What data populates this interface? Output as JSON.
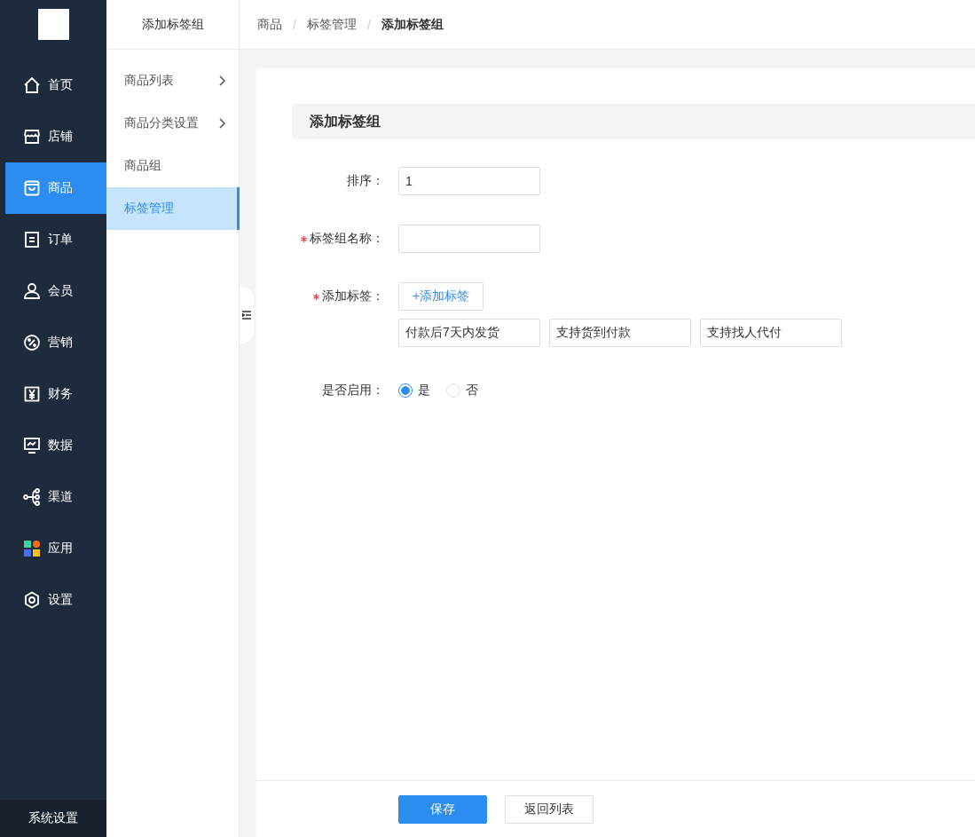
{
  "nav": {
    "items": [
      {
        "label": "首页",
        "selected": false
      },
      {
        "label": "店铺",
        "selected": false
      },
      {
        "label": "商品",
        "selected": true
      },
      {
        "label": "订单",
        "selected": false
      },
      {
        "label": "会员",
        "selected": false
      },
      {
        "label": "营销",
        "selected": false
      },
      {
        "label": "财务",
        "selected": false
      },
      {
        "label": "数据",
        "selected": false
      },
      {
        "label": "渠道",
        "selected": false
      },
      {
        "label": "应用",
        "selected": false
      },
      {
        "label": "设置",
        "selected": false
      }
    ],
    "footer": "系统设置"
  },
  "submenu": {
    "title": "添加标签组",
    "items": [
      {
        "label": "商品列表",
        "expandable": true,
        "selected": false
      },
      {
        "label": "商品分类设置",
        "expandable": true,
        "selected": false
      },
      {
        "label": "商品组",
        "expandable": false,
        "selected": false
      },
      {
        "label": "标签管理",
        "expandable": false,
        "selected": true
      }
    ]
  },
  "breadcrumb": {
    "separator": "/",
    "items": [
      "商品",
      "标签管理",
      "添加标签组"
    ]
  },
  "form": {
    "title": "添加标签组",
    "rows": [
      {
        "kind": "input",
        "label": "排序：",
        "required": false,
        "value": "1"
      },
      {
        "kind": "input",
        "label": "标签组名称：",
        "required": true
      },
      {
        "kind": "tags",
        "label": "添加标签：",
        "required": true,
        "add_button": "+添加标签",
        "tags": [
          "付款后7天内发货",
          "支持货到付款",
          "支持找人代付"
        ]
      },
      {
        "kind": "radio",
        "label": "是否启用：",
        "required": false,
        "options": [
          {
            "label": "是",
            "selected": true
          },
          {
            "label": "否",
            "selected": false
          }
        ]
      }
    ]
  },
  "buttons": [
    {
      "kind": "primary",
      "label": "保存"
    },
    {
      "kind": "default",
      "label": "返回列表"
    }
  ]
}
